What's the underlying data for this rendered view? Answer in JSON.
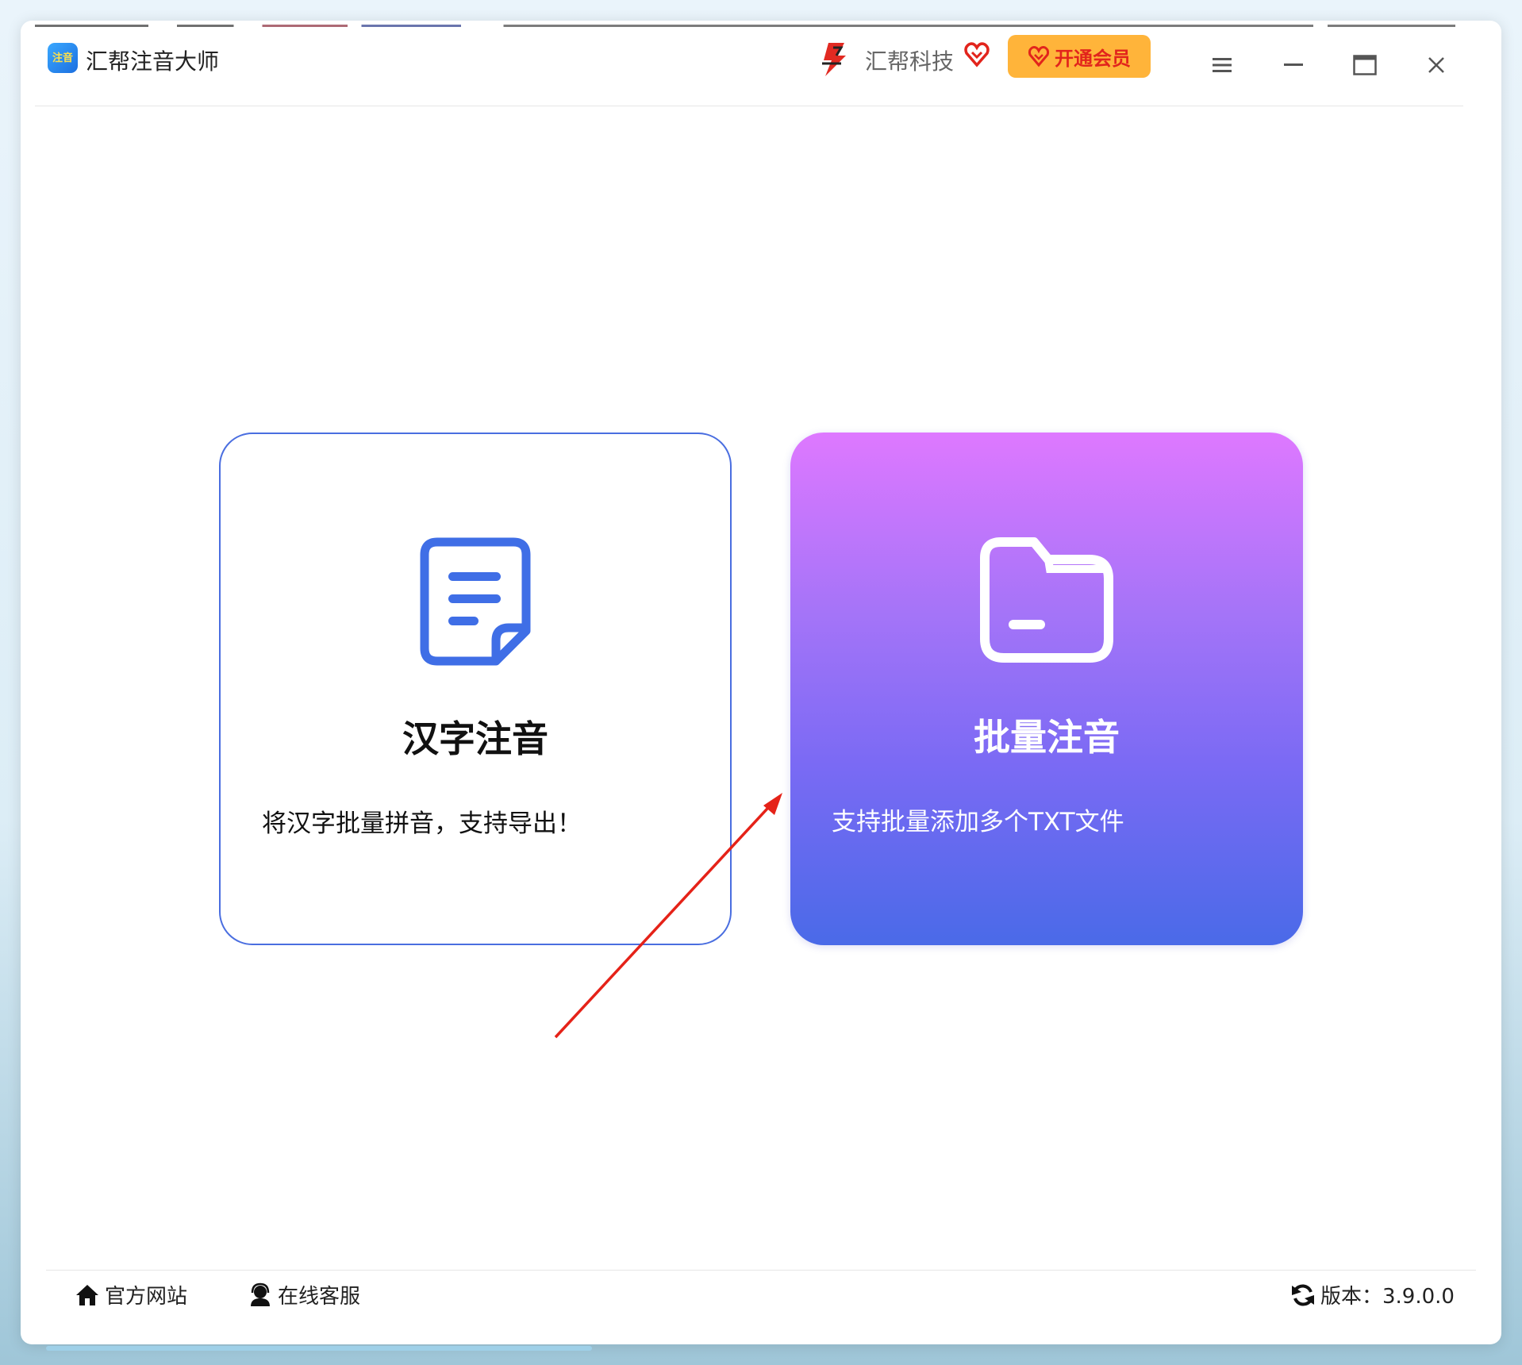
{
  "app": {
    "title": "汇帮注音大师",
    "logo_text": "注音"
  },
  "header": {
    "brand_name": "汇帮科技",
    "vip_label": "开通会员",
    "accent_color": "#ffb43a",
    "vip_text_color": "#e2241c"
  },
  "cards": [
    {
      "title": "汉字注音",
      "description": "将汉字批量拼音，支持导出！",
      "icon": "document-icon"
    },
    {
      "title": "批量注音",
      "description": "支持批量添加多个TXT文件",
      "icon": "folder-icon"
    }
  ],
  "footer": {
    "website_label": "官方网站",
    "support_label": "在线客服",
    "version_label": "版本：3.9.0.0"
  }
}
